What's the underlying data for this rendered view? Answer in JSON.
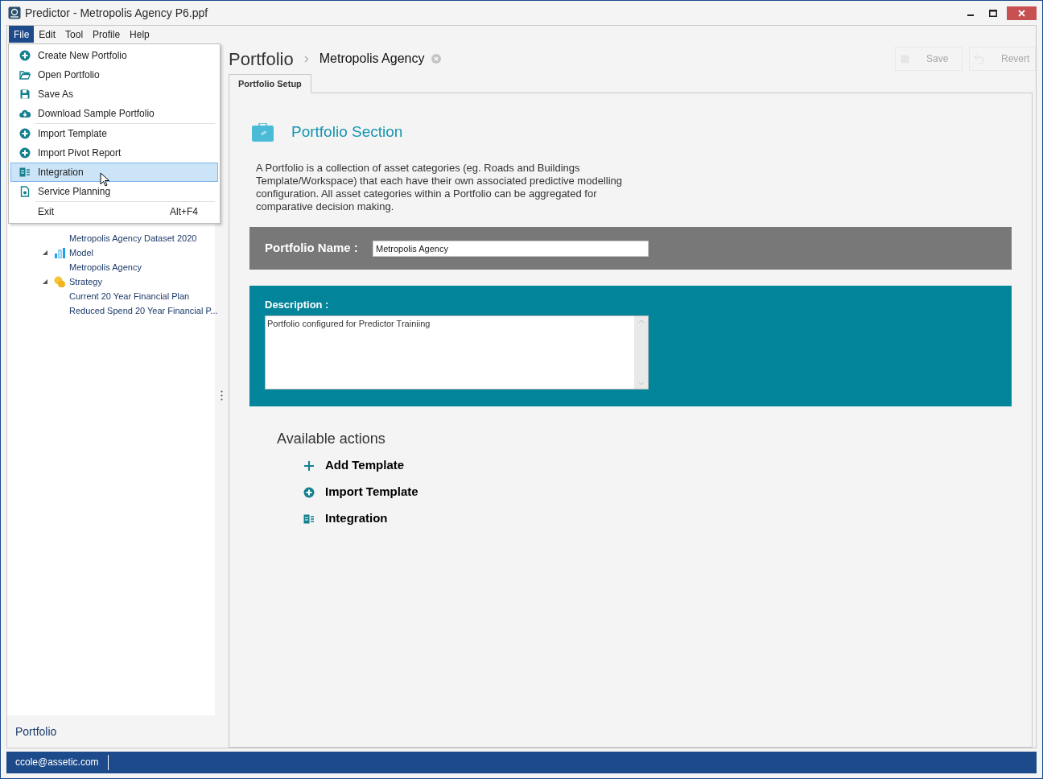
{
  "window": {
    "title": "Predictor - Metropolis Agency P6.ppf"
  },
  "menu_bar": [
    {
      "label": "File",
      "selected": true
    },
    {
      "label": "Edit",
      "selected": false
    },
    {
      "label": "Tool",
      "selected": false
    },
    {
      "label": "Profile",
      "selected": false
    },
    {
      "label": "Help",
      "selected": false
    }
  ],
  "file_menu": [
    {
      "label": "Create New Portfolio",
      "kind": "plus-circle",
      "selected": false,
      "separator_after": false
    },
    {
      "label": "Open Portfolio",
      "kind": "folder",
      "selected": false,
      "separator_after": false
    },
    {
      "label": "Save As",
      "kind": "save",
      "selected": false,
      "separator_after": false
    },
    {
      "label": "Download Sample Portfolio",
      "kind": "cloud",
      "selected": false,
      "separator_after": true
    },
    {
      "label": "Import Template",
      "kind": "plus-circle",
      "selected": false,
      "separator_after": false
    },
    {
      "label": "Import Pivot Report",
      "kind": "plus-circle",
      "selected": false,
      "separator_after": false
    },
    {
      "label": "Integration",
      "kind": "integration",
      "selected": true,
      "separator_after": false
    },
    {
      "label": "Service Planning",
      "kind": "document",
      "selected": false,
      "separator_after": true
    },
    {
      "label": "Exit",
      "shortcut": "Alt+F4",
      "selected": false,
      "separator_after": false
    }
  ],
  "sidebar": {
    "tree": [
      {
        "children": [
          {
            "label": "Metropolis Agency Dataset 2020"
          }
        ]
      },
      {
        "label": "Model",
        "kind": "chart",
        "expanded": true,
        "children": [
          {
            "label": "Metropolis Agency"
          }
        ]
      },
      {
        "label": "Strategy",
        "kind": "coins",
        "expanded": true,
        "children": [
          {
            "label": "Current 20 Year Financial Plan"
          },
          {
            "label": "Reduced Spend 20 Year Financial P..."
          }
        ]
      }
    ],
    "footer": "Portfolio"
  },
  "breadcrumb": {
    "root": "Portfolio",
    "current": "Metropolis Agency"
  },
  "toolbar": [
    {
      "label": "Save",
      "kind": "save",
      "disabled": true
    },
    {
      "label": "Revert",
      "kind": "undo",
      "disabled": true
    }
  ],
  "tabs": [
    {
      "label": "Portfolio Setup",
      "selected": true
    }
  ],
  "section": {
    "title": "Portfolio Section",
    "description": "A Portfolio is a collection of asset categories (eg. Roads and Buildings Template/Workspace) that each have their own associated predictive modelling configuration. All asset categories within a Portfolio can be aggregated for comparative decision making."
  },
  "portfolio_name": {
    "label": "Portfolio Name :",
    "value": "Metropolis Agency"
  },
  "description_field": {
    "label": "Description :",
    "value": "Portfolio configured for Predictor Trainiing"
  },
  "actions": {
    "title": "Available actions",
    "items": [
      {
        "label": "Add Template",
        "kind": "plus"
      },
      {
        "label": "Import Template",
        "kind": "plus-circle"
      },
      {
        "label": "Integration",
        "kind": "integration"
      }
    ]
  },
  "status_bar": {
    "user": "ccole@assetic.com"
  }
}
